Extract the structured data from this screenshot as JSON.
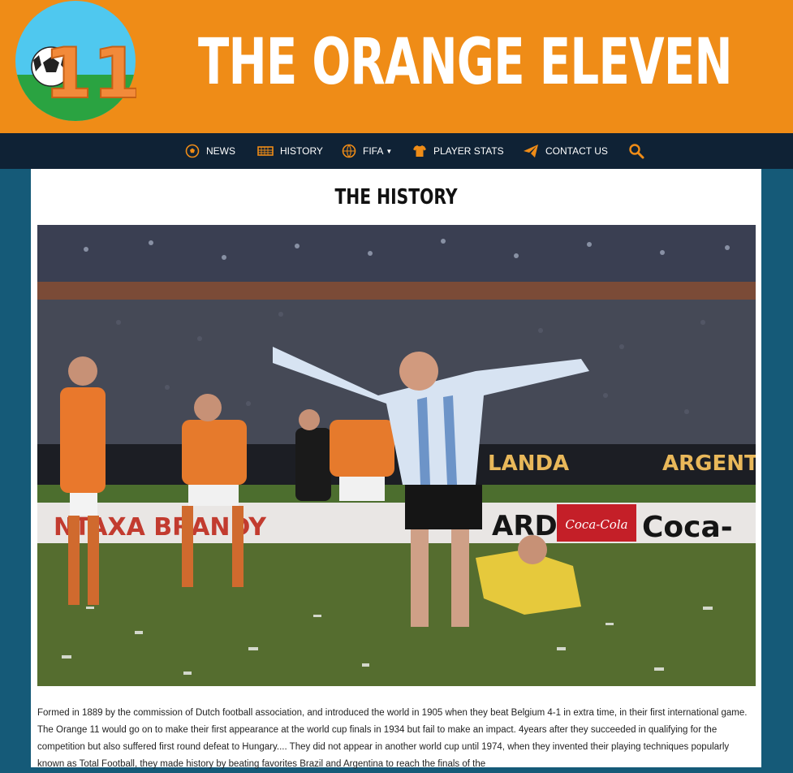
{
  "site": {
    "title": "THE ORANGE ELEVEN",
    "logo_number": "11"
  },
  "nav": {
    "items": [
      {
        "label": "NEWS",
        "icon": "soccer-ball-icon"
      },
      {
        "label": "HISTORY",
        "icon": "goal-net-icon"
      },
      {
        "label": "FIFA",
        "icon": "fifa-trophy-icon",
        "has_dropdown": true
      },
      {
        "label": "PLAYER STATS",
        "icon": "jersey-icon"
      },
      {
        "label": "CONTACT US",
        "icon": "paper-plane-icon"
      }
    ],
    "search_icon": "search-icon"
  },
  "page": {
    "title": "THE HISTORY",
    "photo_signage": {
      "left": "LANDA",
      "right": "ARGENT",
      "sponsor_1": "Coca-Cola",
      "sponsor_2": "Coca-",
      "sponsor_3": "ARDI",
      "sponsor_4": "NTAXA BRANDY"
    },
    "body": "Formed in 1889 by the commission of Dutch football association, and introduced the world in 1905 when they beat Belgium 4-1 in extra time, in their first international game. The Orange 11 would go on to make their first appearance at the world cup finals in 1934 but fail to make an impact. 4years after they succeeded in qualifying for the competition but also suffered first round defeat to Hungary.... They did not appear in another world cup until 1974, when they invented their playing techniques popularly known as Total Football, they made history by beating favorites Brazil and Argentina to reach the finals of the"
  },
  "colors": {
    "header": "#ef8c17",
    "nav": "#0f2235",
    "page_bg": "#155a78",
    "accent": "#ef8c17"
  }
}
